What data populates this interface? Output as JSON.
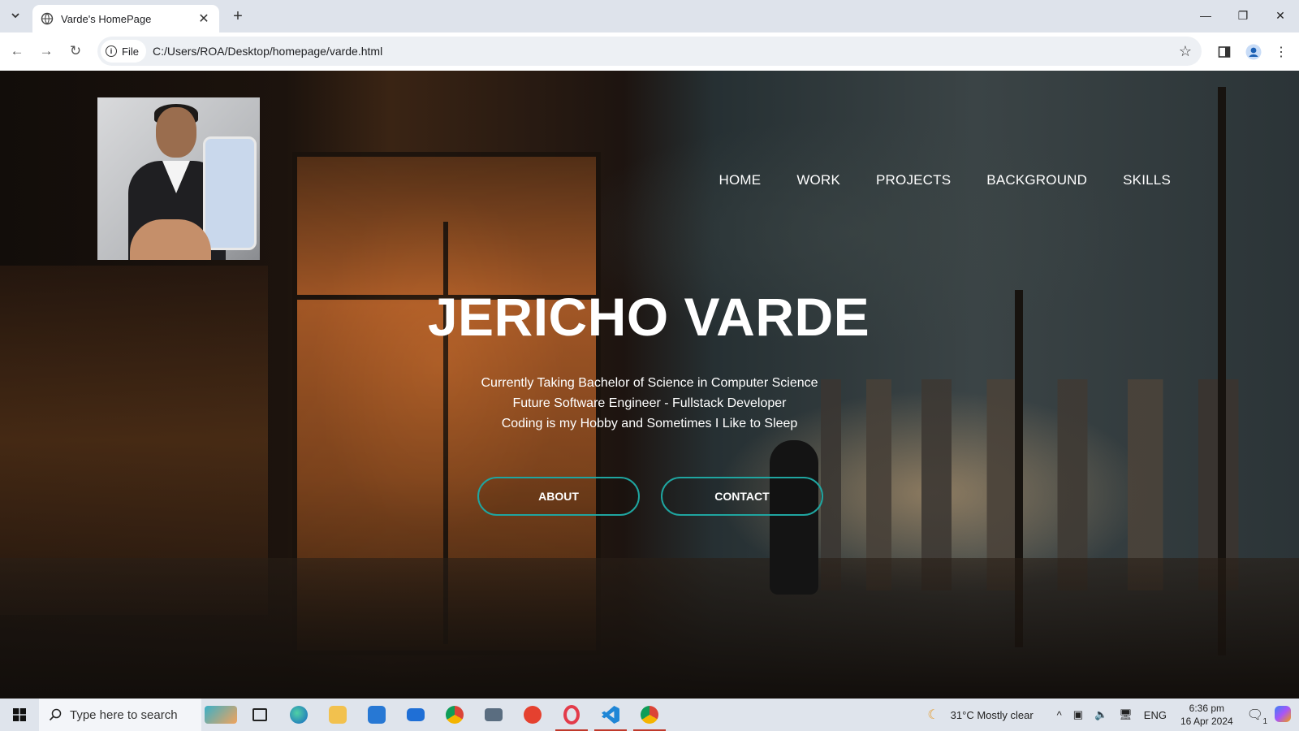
{
  "browser": {
    "tab_title": "Varde's HomePage",
    "site_chip": "File",
    "url": "C:/Users/ROA/Desktop/homepage/varde.html"
  },
  "site": {
    "nav": [
      "HOME",
      "WORK",
      "PROJECTS",
      "BACKGROUND",
      "SKILLS"
    ],
    "name": "JERICHO VARDE",
    "lines": [
      "Currently Taking Bachelor of Science in Computer Science",
      "Future Software Engineer - Fullstack Developer",
      "Coding is my Hobby and Sometimes I Like to Sleep"
    ],
    "buttons": {
      "about": "ABOUT",
      "contact": "CONTACT"
    },
    "accent": "#1fa5a0"
  },
  "taskbar": {
    "search_placeholder": "Type here to search",
    "weather": "31°C  Mostly clear",
    "language": "ENG",
    "time": "6:36 pm",
    "date": "16 Apr 2024",
    "notification_count": "1"
  }
}
